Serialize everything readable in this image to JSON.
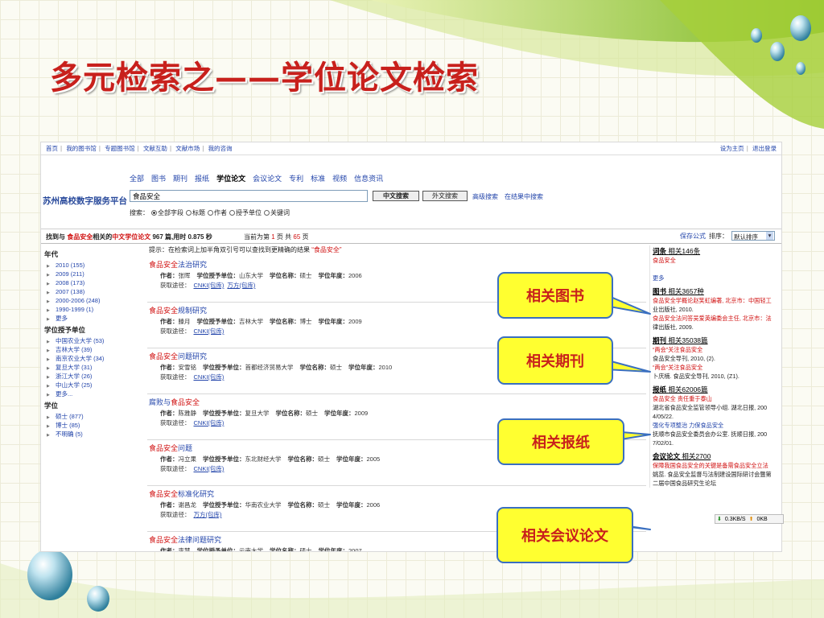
{
  "slide": {
    "title": "多元检索之——学位论文检索"
  },
  "topnav": [
    "首页",
    "我的图书馆",
    "专题图书馆",
    "文献互助",
    "文献市场",
    "我的咨询"
  ],
  "topright": [
    "设为主页",
    "退出登录"
  ],
  "brand": "苏州高校数字服务平台",
  "categories": [
    "全部",
    "图书",
    "期刊",
    "报纸",
    "学位论文",
    "会议论文",
    "专利",
    "标准",
    "视频",
    "信息资讯"
  ],
  "search": {
    "query": "食品安全",
    "btn_cn": "中文搜索",
    "btn_foreign": "外文搜索",
    "advanced": "高级搜索",
    "in_results": "在结果中搜索"
  },
  "scope": {
    "label": "搜索：",
    "options": [
      "全部字段",
      "标题",
      "作者",
      "授予单位",
      "关键词"
    ]
  },
  "status": {
    "p1": "找到与",
    "term": "食品安全",
    "p2": "相关的",
    "kind": "中文学位论文",
    "p3": "967 篇,用时 0.875 秒",
    "pg1": "当前为第",
    "cur": "1",
    "pg2": "页 共",
    "total": "65",
    "pg3": "页",
    "save": "保存公式",
    "sort_label": "排序：",
    "sort_value": "默认排序"
  },
  "left": {
    "year_title": "年代",
    "years": [
      "2010 (155)",
      "2009 (211)",
      "2008 (173)",
      "2007 (138)",
      "2000-2006 (248)",
      "1990-1999 (1)",
      "更多"
    ],
    "unit_title": "学位授予单位",
    "units": [
      "中国农业大学 (53)",
      "吉林大学 (39)",
      "南京农业大学 (34)",
      "复旦大学 (31)",
      "浙江大学 (26)",
      "中山大学 (25)",
      "更多..."
    ],
    "degree_title": "学位",
    "degrees": [
      "硕士 (877)",
      "博士 (85)",
      "不明确 (5)"
    ]
  },
  "hint": {
    "text": "提示：在检索词上加半角双引号可以查找到更精确的结果",
    "quote": "“食品安全”"
  },
  "labels": {
    "author": "作者：",
    "unit": "学位授予单位：",
    "degree": "学位名称：",
    "year": "学位年度：",
    "get": "获取途径："
  },
  "results": [
    {
      "hl": "食品安全",
      "rest": "法治研究",
      "author": "张晖",
      "unit": "山东大学",
      "degree": "硕士",
      "year": "2006",
      "links": [
        "CNKI(包库)",
        "万方(包库)"
      ]
    },
    {
      "hl": "食品安全",
      "rest": "规制研究",
      "author": "滕月",
      "unit": "吉林大学",
      "degree": "博士",
      "year": "2009",
      "links": [
        "CNKI(包库)"
      ]
    },
    {
      "hl": "食品安全",
      "rest": "问题研究",
      "author": "安雪铭",
      "unit": "首都经济贸易大学",
      "degree": "硕士",
      "year": "2010",
      "links": [
        "CNKI(包库)"
      ]
    },
    {
      "pre": "腐败与",
      "hl": "食品安全",
      "rest": "",
      "author": "陈雅静",
      "unit": "复旦大学",
      "degree": "硕士",
      "year": "2009",
      "links": [
        "CNKI(包库)"
      ]
    },
    {
      "hl": "食品安全",
      "rest": "问题",
      "author": "冯立果",
      "unit": "东北财经大学",
      "degree": "硕士",
      "year": "2005",
      "links": [
        "CNKI(包库)"
      ]
    },
    {
      "hl": "食品安全",
      "rest": "标准化研究",
      "author": "谢昌龙",
      "unit": "华南农业大学",
      "degree": "硕士",
      "year": "2006",
      "links": [
        "万方(包库)"
      ]
    },
    {
      "hl": "食品安全",
      "rest": "法律问题研究",
      "author": "李慧",
      "unit": "云南大学",
      "degree": "硕士",
      "year": "2007",
      "links": []
    }
  ],
  "side": {
    "ci": {
      "title": "词条",
      "count": "相关146条",
      "item": "食品安全",
      "more": "更多"
    },
    "tushu": {
      "title": "图书",
      "count": "相关3657种",
      "l1": "食品安全学概论赵笑虹编著, 北京市：中国轻工",
      "l2": "业出版社, 2010.",
      "l3": "食品安全法问答吴爱英编委会主任, 北京市：法",
      "l4": "律出版社, 2009."
    },
    "qikan": {
      "title": "期刊",
      "count": "相关35038篇",
      "l1": "“两会”关注食品安全",
      "l2": "食品安全导刊, 2010, (2).",
      "l3": "“两会”关注食品安全",
      "l4": "卜庆楠. 食品安全导刊, 2010, (Z1)."
    },
    "baozhi": {
      "title": "报纸",
      "count": "相关62006篇",
      "l1": "食品安全 责任重于泰山",
      "l2": "湖北省食品安全监管领导小组. 湖北日报, 200",
      "l3": "4/05/22.",
      "l4": "强化专项整治 力保食品安全",
      "l5": "抚顺市食品安全委员会办公室. 抚顺日报, 200",
      "l6": "7/02/01."
    },
    "huiyi": {
      "title": "会议论文",
      "count": "相关2700",
      "l1": "保障我国食品安全的关键是备需食品安全立法",
      "l2": "姚蕊. 食品安全监督与法制建设国际研讨会暨第",
      "l3": "二届中国食品研究生论坛"
    }
  },
  "download": {
    "down": "0.3KB/S",
    "up": "0KB"
  },
  "callouts": {
    "books": "相关图书",
    "journals": "相关期刊",
    "papers": "相关报纸",
    "conf": "相关会议论文"
  },
  "colors": {
    "title": "#c8201c",
    "callout_bg": "#ffff30",
    "link": "#2244aa",
    "highlight": "#d01010",
    "swoosh": "#8fc21f"
  }
}
